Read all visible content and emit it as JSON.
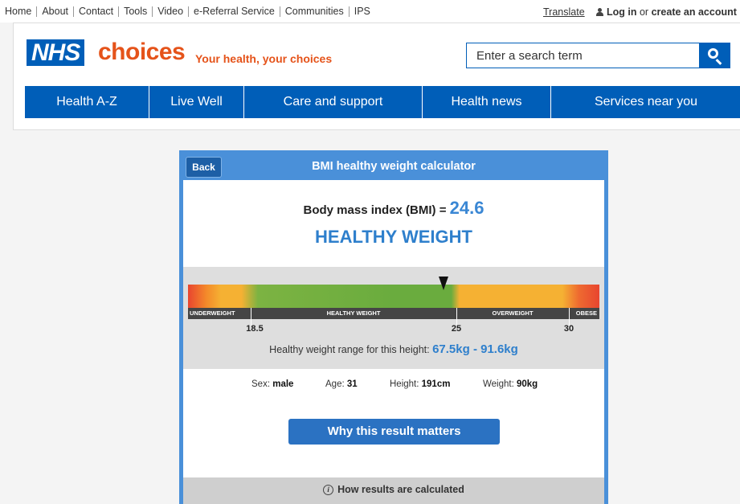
{
  "utility": {
    "links": [
      "Home",
      "About",
      "Contact",
      "Tools",
      "Video",
      "e-Referral Service",
      "Communities",
      "IPS"
    ],
    "translate": "Translate",
    "login": "Log in",
    "or": "or",
    "create_account": "create an account"
  },
  "header": {
    "logo_nhs": "NHS",
    "logo_choices": "choices",
    "tagline": "Your health, your choices",
    "search_placeholder": "Enter a search term"
  },
  "nav": [
    "Health A-Z",
    "Live Well",
    "Care and support",
    "Health news",
    "Services near you"
  ],
  "calculator": {
    "back_label": "Back",
    "title": "BMI healthy weight calculator",
    "bmi_label": "Body mass index (BMI) =",
    "bmi_value": "24.6",
    "bmi_value_num": 24.6,
    "status": "HEALTHY WEIGHT",
    "gauge": {
      "segments": [
        "UNDERWEIGHT",
        "HEALTHY WEIGHT",
        "OVERWEIGHT",
        "OBESE"
      ],
      "ticks": [
        "18.5",
        "25",
        "30"
      ]
    },
    "range_label": "Healthy weight range for this height:",
    "range_value": "67.5kg - 91.6kg",
    "stats": {
      "sex_label": "Sex:",
      "sex_value": "male",
      "age_label": "Age:",
      "age_value": "31",
      "height_label": "Height:",
      "height_value": "191cm",
      "weight_label": "Weight:",
      "weight_value": "90kg"
    },
    "why_button": "Why this result matters",
    "how_calculated": "How results are calculated"
  },
  "colors": {
    "brand_blue": "#005eb8",
    "accent_orange": "#e5531a",
    "panel_blue": "#4a90d9",
    "value_blue": "#2e7fcc"
  }
}
